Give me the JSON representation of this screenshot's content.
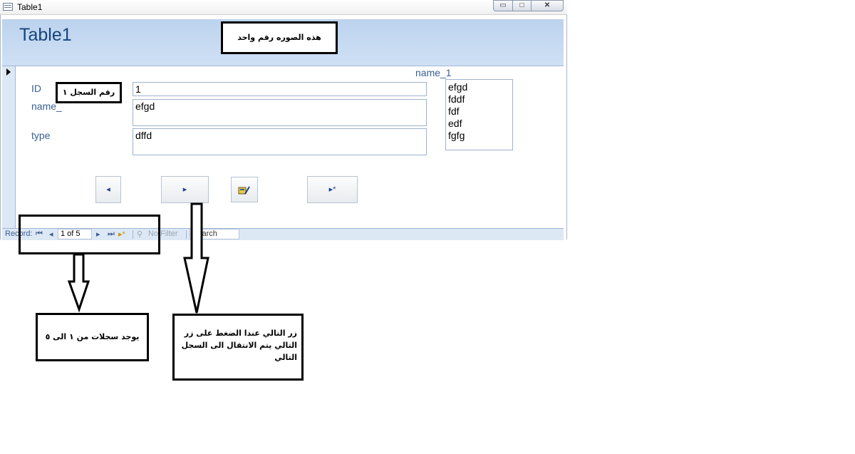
{
  "window": {
    "title": "Table1",
    "controls": {
      "minimize": "▭",
      "maximize": "□",
      "close": "✕"
    }
  },
  "form": {
    "title": "Table1",
    "list_label": "name_1",
    "fields": [
      {
        "label": "ID",
        "value": "1"
      },
      {
        "label": "name_",
        "value": "efgd"
      },
      {
        "label": "type",
        "value": "dffd"
      }
    ],
    "list_items": [
      "efgd",
      "fddf",
      "fdf",
      "edf",
      "fgfg"
    ],
    "buttons": {
      "prev": "◂",
      "next": "▸",
      "edit_icon": "edit-record-icon",
      "new": "▸*"
    }
  },
  "navigator": {
    "label": "Record:",
    "first": "⏮",
    "prev": "◂",
    "position": "1 of 5",
    "next": "▸",
    "last": "⏭",
    "new": "▸*",
    "filter": "No Filter",
    "search": "Search"
  },
  "annotations": {
    "picture_one": "هذه الصوره رقم واحد",
    "record_one": "رقم السجل ١",
    "records_range": "يوجد سجلات من ١ الى ٥",
    "next_button_note": "زر التالي عندا الضغط على زر التالي يتم الانتقال الى السجل التالي"
  }
}
